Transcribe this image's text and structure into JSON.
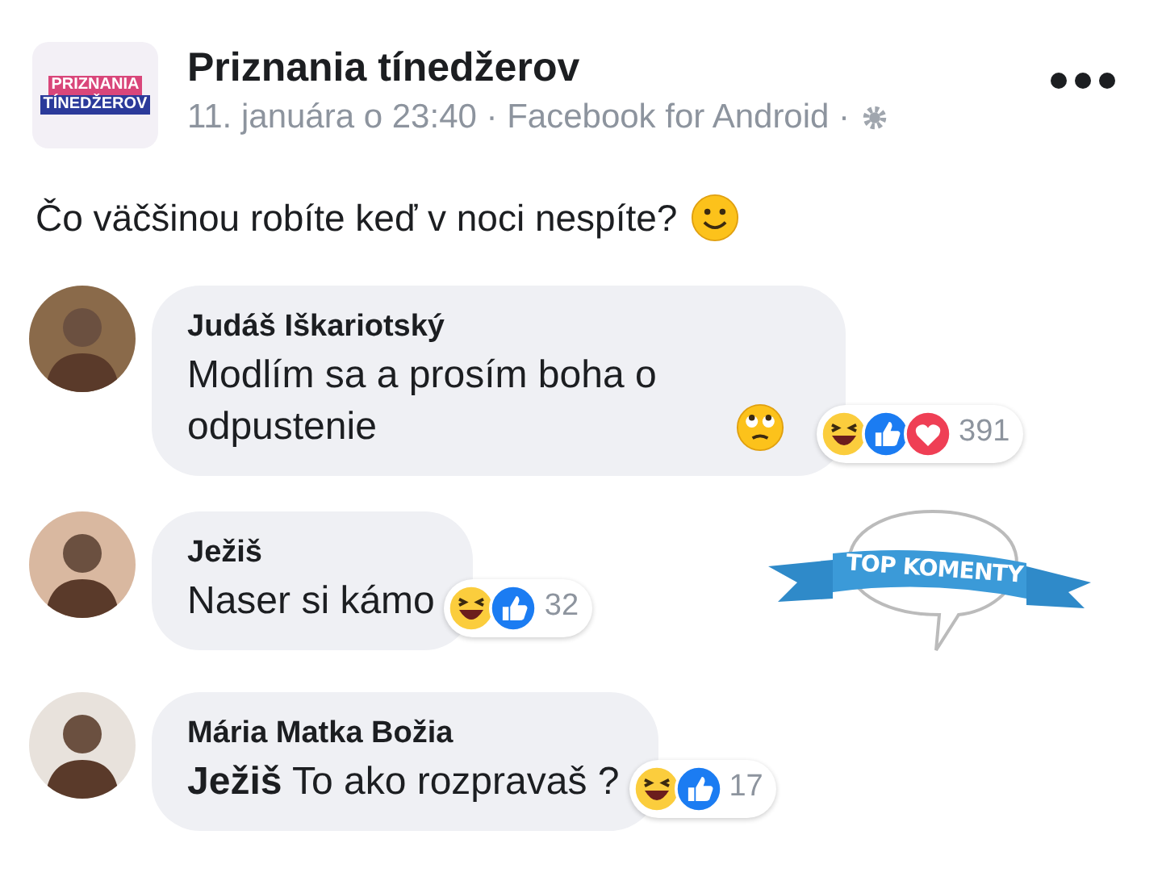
{
  "post": {
    "logo": {
      "line_1": "PRIZNANIA",
      "line_2": "TÍNEDŽEROV"
    },
    "author": "Priznania tínedžerov",
    "meta": "11. januára o 23:40 · Facebook for Android ·",
    "text": "Čo väčšinou robíte keď v noci nespíte?",
    "emoji": {
      "kind": "smile"
    }
  },
  "comments": [
    {
      "author": "Judáš Iškariotský",
      "text": "Modlím sa a prosím boha o odpustenie",
      "emoji": {
        "kind": "eye-roll"
      },
      "reactions": [
        {
          "kind": "haha"
        },
        {
          "kind": "like"
        },
        {
          "kind": "love"
        }
      ],
      "count": "391"
    },
    {
      "author": "Ježiš",
      "text": "Naser si kámo",
      "reactions": [
        {
          "kind": "haha"
        },
        {
          "kind": "like"
        }
      ],
      "count": "32",
      "sticker": "TOP KOMENTY"
    },
    {
      "author": "Mária Matka Božia",
      "text": "**Ježiš** To ako rozpravaš ?",
      "reactions": [
        {
          "kind": "haha"
        },
        {
          "kind": "like"
        }
      ],
      "count": "17"
    }
  ]
}
